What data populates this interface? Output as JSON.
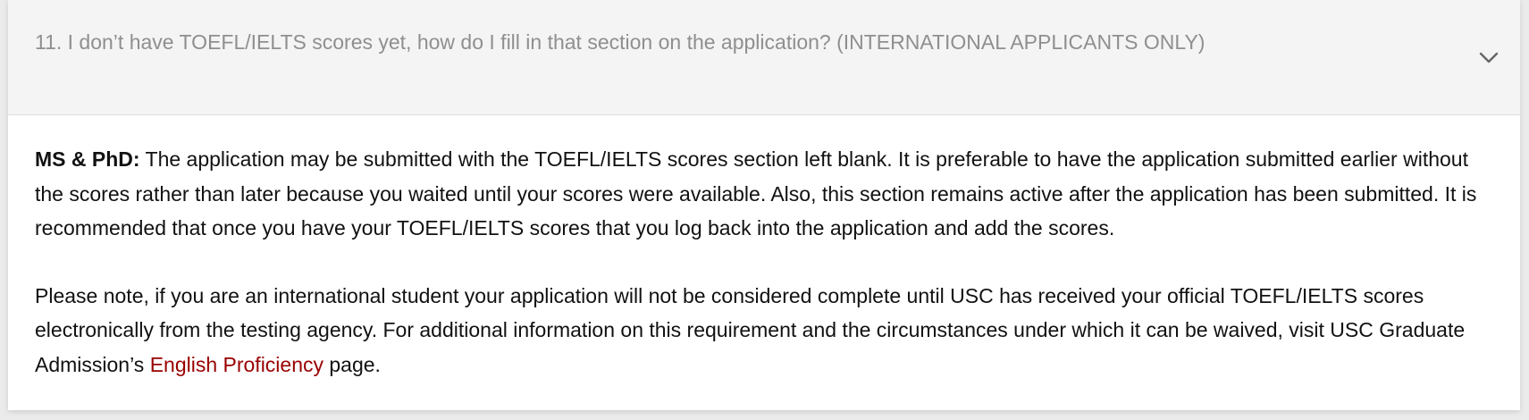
{
  "faq_item": {
    "question": "11. I don’t have TOEFL/IELTS scores yet, how do I fill in that section on the application? (INTERNATIONAL APPLICANTS ONLY)",
    "toggle_icon": "chevron-down-icon",
    "answer": {
      "paragraph_1_lead": "MS & PhD:",
      "paragraph_1_text": " The application may be submitted with the TOEFL/IELTS scores section left blank. It is preferable to have the application submitted earlier without the scores rather than later because you waited until your scores were available. Also, this section remains active after the application has been submitted. It is recommended that once you have your TOEFL/IELTS scores that you log back into the application and add the scores.",
      "paragraph_2_text": "Please note, if you are an international student your application will not be considered complete until USC has received your official TOEFL/IELTS scores electronically from the testing agency. For additional information on this requirement and the circumstances under which it can be waived, visit USC Graduate Admission’s ",
      "paragraph_2_link": "English Proficiency",
      "paragraph_2_end": " page."
    }
  },
  "colors": {
    "link": "#990000",
    "header_bg": "#f4f4f4",
    "question_text": "#8f8f8f",
    "body_text": "#111111"
  }
}
